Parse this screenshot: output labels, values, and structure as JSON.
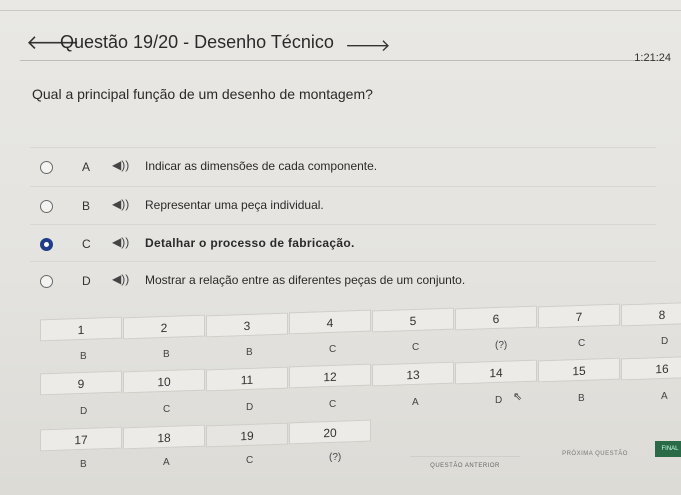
{
  "header": {
    "title": "Questão 19/20 - Desenho Técnico",
    "timer": "1:21:24"
  },
  "question": "Qual a principal função de um desenho de montagem?",
  "options": [
    {
      "letter": "A",
      "text": "Indicar as dimensões de cada componente.",
      "selected": false
    },
    {
      "letter": "B",
      "text": "Representar uma peça individual.",
      "selected": false
    },
    {
      "letter": "C",
      "text": "Detalhar o processo de fabricação.",
      "selected": true
    },
    {
      "letter": "D",
      "text": "Mostrar a relação entre as diferentes peças de um conjunto.",
      "selected": false
    }
  ],
  "navigator": {
    "row1": [
      {
        "num": "1",
        "ans": "B"
      },
      {
        "num": "2",
        "ans": "B"
      },
      {
        "num": "3",
        "ans": "B"
      },
      {
        "num": "4",
        "ans": "C"
      },
      {
        "num": "5",
        "ans": "C"
      },
      {
        "num": "6",
        "ans": "(?)"
      },
      {
        "num": "7",
        "ans": "C"
      },
      {
        "num": "8",
        "ans": "D"
      }
    ],
    "row2": [
      {
        "num": "9",
        "ans": "D"
      },
      {
        "num": "10",
        "ans": "C"
      },
      {
        "num": "11",
        "ans": "D"
      },
      {
        "num": "12",
        "ans": "C"
      },
      {
        "num": "13",
        "ans": "A"
      },
      {
        "num": "14",
        "ans": "D"
      },
      {
        "num": "15",
        "ans": "B"
      },
      {
        "num": "16",
        "ans": "A"
      }
    ],
    "row3": [
      {
        "num": "17",
        "ans": "B"
      },
      {
        "num": "18",
        "ans": "A"
      },
      {
        "num": "19",
        "ans": "C"
      },
      {
        "num": "20",
        "ans": "(?)"
      }
    ]
  },
  "footer": {
    "prev": "QUESTÃO ANTERIOR",
    "next": "PRÓXIMA QUESTÃO",
    "finish": "FINAL"
  },
  "icons": {
    "back": "arrow-left-icon",
    "forward": "arrow-right-icon",
    "speaker": "speaker-icon"
  }
}
